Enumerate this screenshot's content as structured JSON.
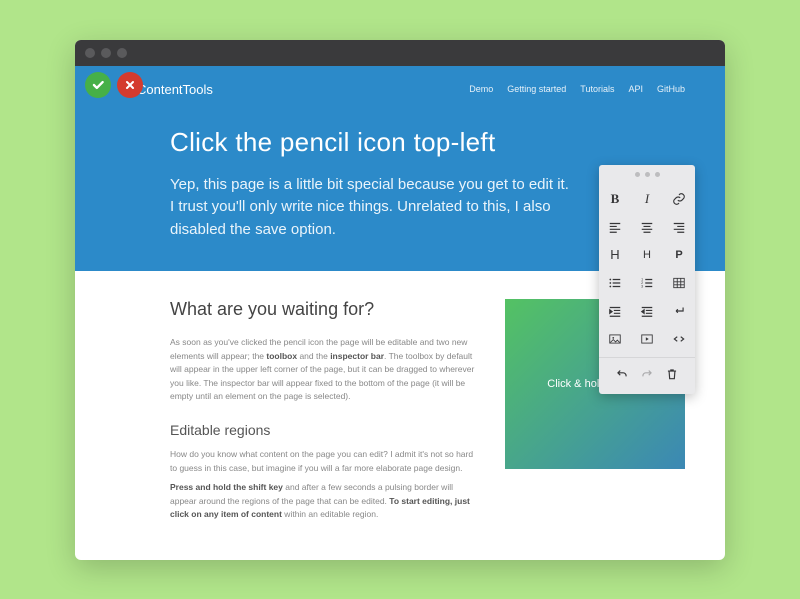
{
  "brand": "ContentTools",
  "nav": [
    "Demo",
    "Getting started",
    "Tutorials",
    "API",
    "GitHub"
  ],
  "hero": {
    "title": "Click the pencil icon top-left",
    "sub": "Yep, this page is a little bit special because you get to edit it. I trust you'll only write nice things. Unrelated to this, I also disabled the save option."
  },
  "body": {
    "h2": "What are you waiting for?",
    "p1a": "As soon as you've clicked the pencil icon the page will be editable and two new elements will appear; the ",
    "p1b": "toolbox",
    "p1c": " and the ",
    "p1d": "inspector bar",
    "p1e": ". The toolbox by default will appear in the upper left corner of the page, but it can be dragged to wherever you like. The inspector bar will appear fixed to the bottom of the page (it will be empty until an element on the page is selected).",
    "h3": "Editable regions",
    "p2": "How do you know what content on the page you can edit? I admit it's not so hard to guess in this case, but imagine if you will a far more elaborate page design.",
    "p3a": "Press and hold the shift key",
    "p3b": " and after a few seconds a pulsing border will appear around the regions of the page that can be edited. ",
    "p3c": "To start editing, just click on any item of content",
    "p3d": " within an editable region."
  },
  "drag": "Click & hold to drag",
  "tools": {
    "bold": "B",
    "italic": "I",
    "h1": "H",
    "h2": "H",
    "para": "P"
  }
}
